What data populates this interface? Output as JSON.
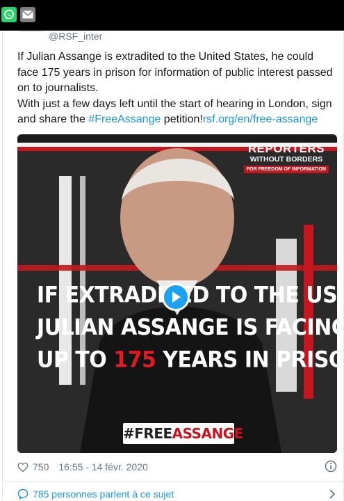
{
  "share": {
    "whatsapp_icon": "whatsapp-icon",
    "email_icon": "envelope-icon"
  },
  "tweet": {
    "handle": "@RSF_inter",
    "text_lines": [
      "If Julian Assange is extradited to the United States, he could",
      "face 175 years in prison for information of public interest passed",
      "on to journalists.",
      "With just a few days left until the start of hearing in London, sign"
    ],
    "last_line_prefix": "and share the ",
    "hashtag": "#FreeAssange",
    "last_line_middle": " petition!",
    "link": "rsf.org/en/free-assange"
  },
  "media": {
    "logo": {
      "line1": "REPORTERS",
      "line2": "WITHOUT BORDERS",
      "line3": "FOR FREEDOM OF INFORMATION"
    },
    "headline": {
      "line1": "IF EXTRADITED TO THE US",
      "line2": "JULIAN ASSANGE IS FACING",
      "line3_prefix": "UP TO ",
      "line3_number": "175",
      "line3_suffix": " YEARS IN PRISON"
    },
    "hashtag_prefix": "#FREE",
    "hashtag_suffix": "ASSANGE",
    "play_icon": "play-icon"
  },
  "meta": {
    "like_count": "750",
    "timestamp": "16:55 - 14 févr. 2020",
    "heart_icon": "heart-icon",
    "info_icon": "info-icon"
  },
  "conversation": {
    "label": "785 personnes parlent à ce sujet",
    "icon": "speech-bubble-icon",
    "chevron": "chevron-right-icon"
  },
  "colors": {
    "link": "#1b95e0",
    "rsf_red": "#c4161c",
    "whatsapp": "#25d366"
  }
}
